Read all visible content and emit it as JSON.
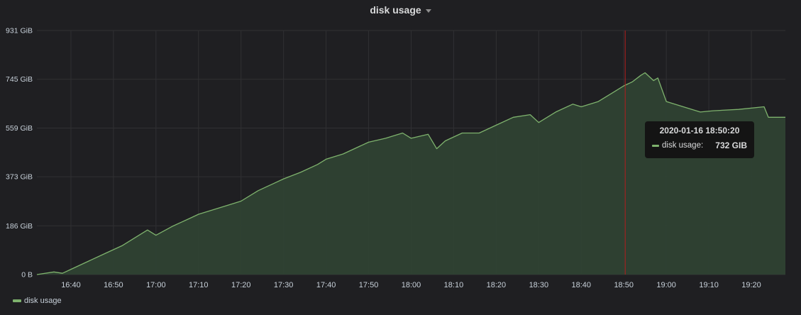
{
  "panel": {
    "title": "disk usage"
  },
  "colors": {
    "series": "#7eb26d",
    "fill": "#2f4233",
    "grid": "#303033",
    "crosshair": "#b11e1e"
  },
  "tooltip": {
    "time": "2020-01-16 18:50:20",
    "series_label": "disk usage:",
    "value": "732 GIB"
  },
  "legend": {
    "items": [
      {
        "label": "disk usage"
      }
    ]
  },
  "chart_data": {
    "type": "area",
    "title": "disk usage",
    "xlabel": "",
    "ylabel": "",
    "y_unit": "GiB",
    "x_range": [
      "16:32",
      "19:28"
    ],
    "ylim": [
      0,
      931
    ],
    "y_ticks": [
      "0 B",
      "186 GiB",
      "373 GiB",
      "559 GiB",
      "745 GiB",
      "931 GiB"
    ],
    "y_tick_values": [
      0,
      186,
      373,
      559,
      745,
      931
    ],
    "x_ticks": [
      "16:40",
      "16:50",
      "17:00",
      "17:10",
      "17:20",
      "17:30",
      "17:40",
      "17:50",
      "18:00",
      "18:10",
      "18:20",
      "18:30",
      "18:40",
      "18:50",
      "19:00",
      "19:10",
      "19:20"
    ],
    "grid": true,
    "legend_position": "bottom-left",
    "crosshair_time": "18:50:20",
    "series": [
      {
        "name": "disk usage",
        "x": [
          "16:32",
          "16:36",
          "16:38",
          "16:40",
          "16:44",
          "16:48",
          "16:52",
          "16:56",
          "16:58",
          "17:00",
          "17:04",
          "17:08",
          "17:10",
          "17:14",
          "17:18",
          "17:20",
          "17:24",
          "17:28",
          "17:30",
          "17:34",
          "17:38",
          "17:40",
          "17:44",
          "17:48",
          "17:50",
          "17:54",
          "17:58",
          "18:00",
          "18:04",
          "18:06",
          "18:08",
          "18:12",
          "18:16",
          "18:20",
          "18:24",
          "18:28",
          "18:30",
          "18:34",
          "18:38",
          "18:40",
          "18:44",
          "18:48",
          "18:50",
          "18:52",
          "18:54",
          "18:55",
          "18:57",
          "18:58",
          "19:00",
          "19:04",
          "19:08",
          "19:11",
          "19:17",
          "19:23",
          "19:24",
          "19:28"
        ],
        "values": [
          0,
          10,
          5,
          20,
          50,
          80,
          110,
          150,
          170,
          150,
          185,
          215,
          230,
          250,
          270,
          280,
          320,
          350,
          365,
          390,
          420,
          440,
          460,
          490,
          505,
          520,
          540,
          520,
          535,
          480,
          510,
          540,
          540,
          570,
          600,
          610,
          580,
          620,
          650,
          640,
          660,
          700,
          720,
          735,
          760,
          770,
          740,
          750,
          660,
          640,
          620,
          625,
          630,
          640,
          600,
          600
        ]
      }
    ]
  }
}
